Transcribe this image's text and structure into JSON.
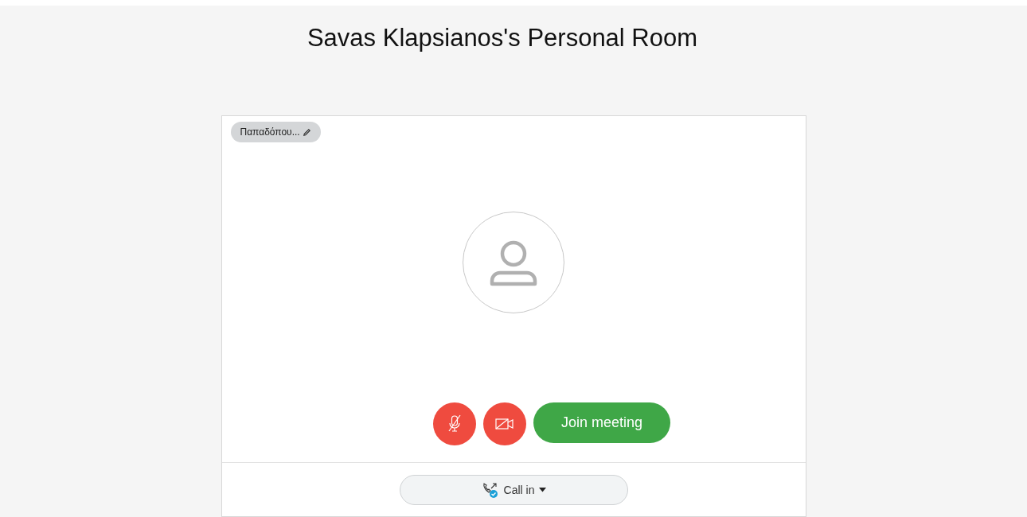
{
  "title": "Savas Klapsianos's Personal Room",
  "name_badge": {
    "label": "Παπαδόπου..."
  },
  "controls": {
    "muted": true,
    "video_off": true,
    "join_label": "Join meeting"
  },
  "call_in": {
    "label": "Call in",
    "verified": true
  }
}
